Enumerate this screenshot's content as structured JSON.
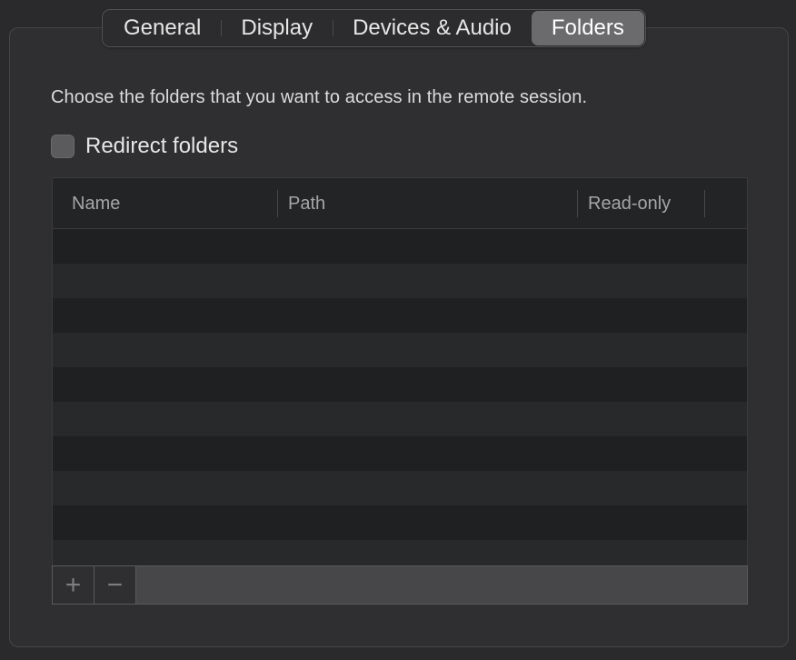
{
  "tabs": [
    {
      "label": "General",
      "active": false
    },
    {
      "label": "Display",
      "active": false
    },
    {
      "label": "Devices & Audio",
      "active": false
    },
    {
      "label": "Folders",
      "active": true
    }
  ],
  "description": "Choose the folders that you want to access in the remote session.",
  "redirect": {
    "label": "Redirect folders",
    "checked": false
  },
  "table": {
    "columns": [
      "Name",
      "Path",
      "Read-only"
    ],
    "rows": []
  },
  "footer": {
    "add_glyph": "+",
    "remove_glyph": "−"
  },
  "icons": {
    "add": "plus-icon",
    "remove": "minus-icon"
  }
}
